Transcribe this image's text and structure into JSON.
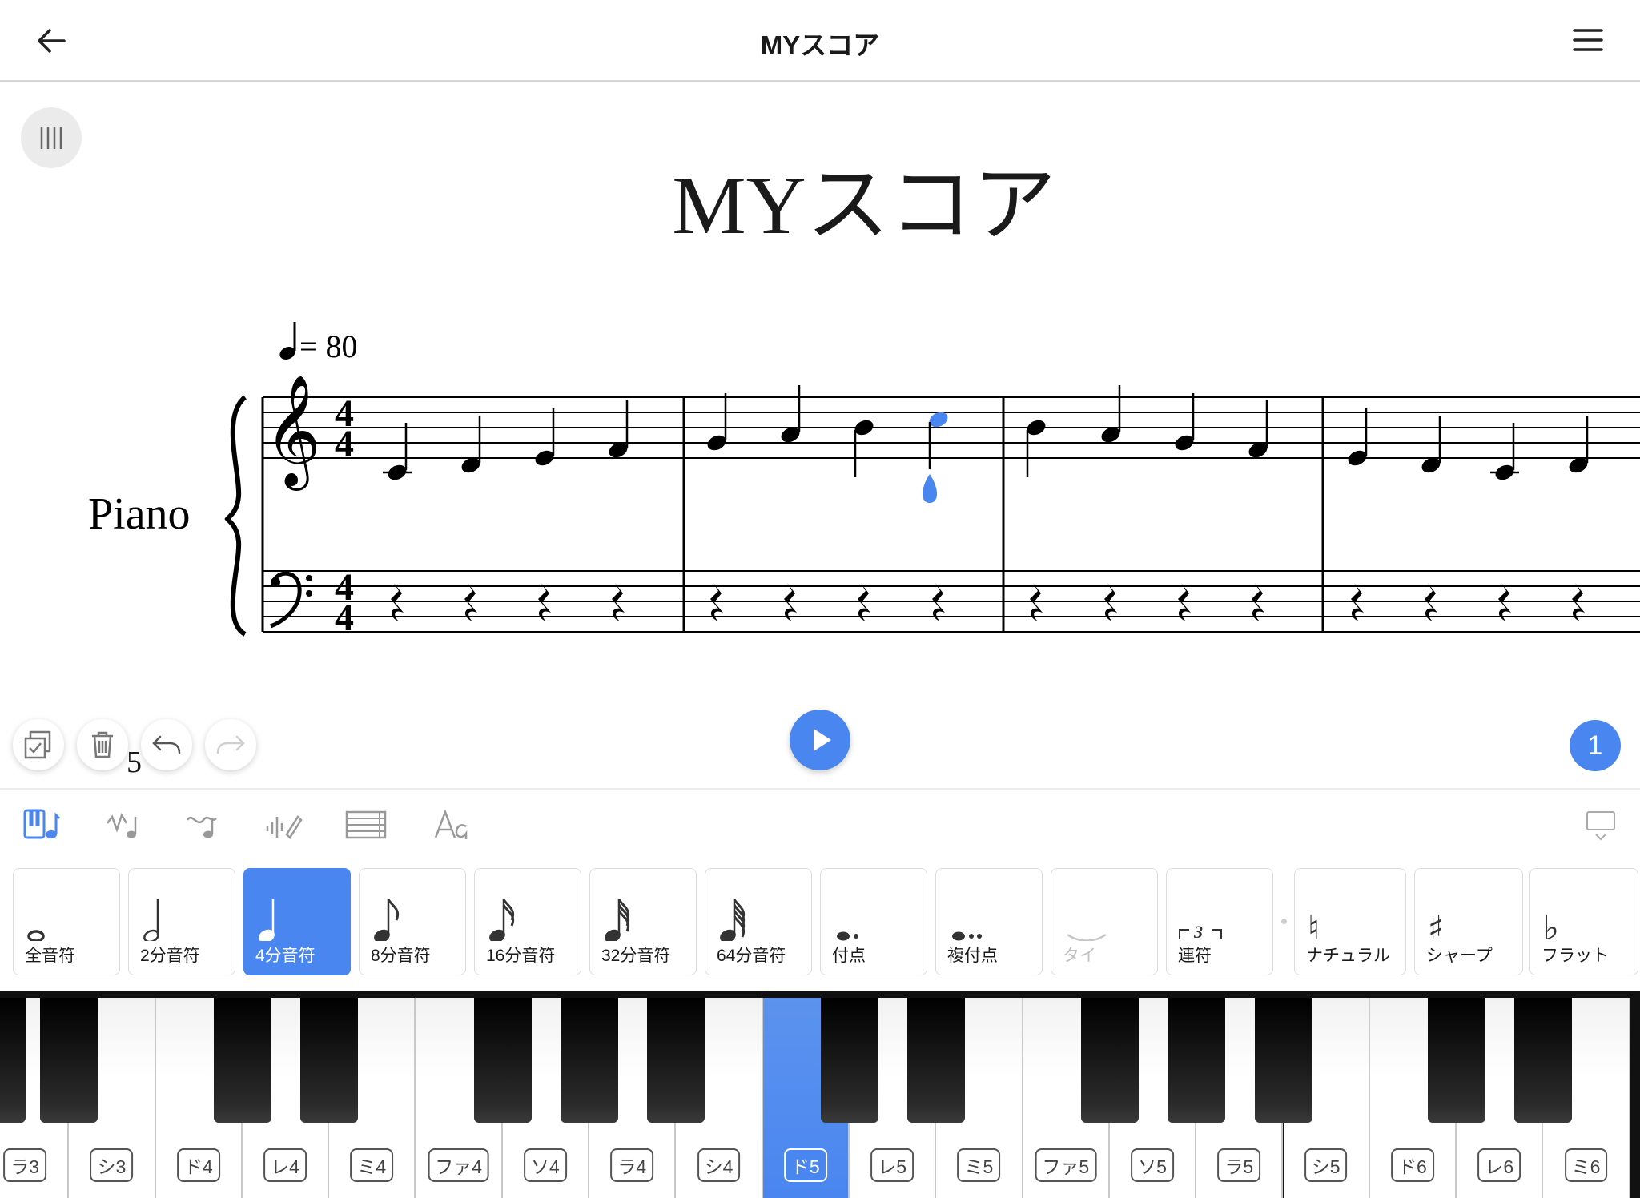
{
  "header": {
    "title": "MYスコア"
  },
  "score": {
    "title": "MYスコア",
    "tempo_value": "= 80",
    "instrument": "Piano",
    "time_signature_top": "4",
    "time_signature_bottom": "4",
    "measure_number": "5"
  },
  "controls": {
    "page_number": "1"
  },
  "palette": {
    "items": [
      {
        "label": "全音符",
        "icon": "whole-note-icon"
      },
      {
        "label": "2分音符",
        "icon": "half-note-icon"
      },
      {
        "label": "4分音符",
        "icon": "quarter-note-icon",
        "selected": true
      },
      {
        "label": "8分音符",
        "icon": "eighth-note-icon"
      },
      {
        "label": "16分音符",
        "icon": "sixteenth-note-icon"
      },
      {
        "label": "32分音符",
        "icon": "thirty-second-note-icon"
      },
      {
        "label": "64分音符",
        "icon": "sixty-fourth-note-icon"
      },
      {
        "label": "付点",
        "icon": "dot-icon"
      },
      {
        "label": "複付点",
        "icon": "double-dot-icon"
      },
      {
        "label": "タイ",
        "icon": "tie-icon",
        "disabled": true
      },
      {
        "label": "連符",
        "icon": "tuplet-icon",
        "glyph_text": "3"
      },
      {
        "label": "ナチュラル",
        "icon": "natural-icon",
        "glyph_text": "♮"
      },
      {
        "label": "シャープ",
        "icon": "sharp-icon",
        "glyph_text": "♯"
      },
      {
        "label": "フラット",
        "icon": "flat-icon",
        "glyph_text": "♭"
      }
    ]
  },
  "keyboard": {
    "white_keys": [
      "ラ3",
      "シ3",
      "ド4",
      "レ4",
      "ミ4",
      "ファ4",
      "ソ4",
      "ラ4",
      "シ4",
      "ド5",
      "レ5",
      "ミ5",
      "ファ5",
      "ソ5",
      "ラ5",
      "シ5",
      "ド6",
      "レ6",
      "ミ6"
    ],
    "active_key": "ド5"
  },
  "colors": {
    "accent": "#4a86f0",
    "divider": "#d6d6d6"
  }
}
